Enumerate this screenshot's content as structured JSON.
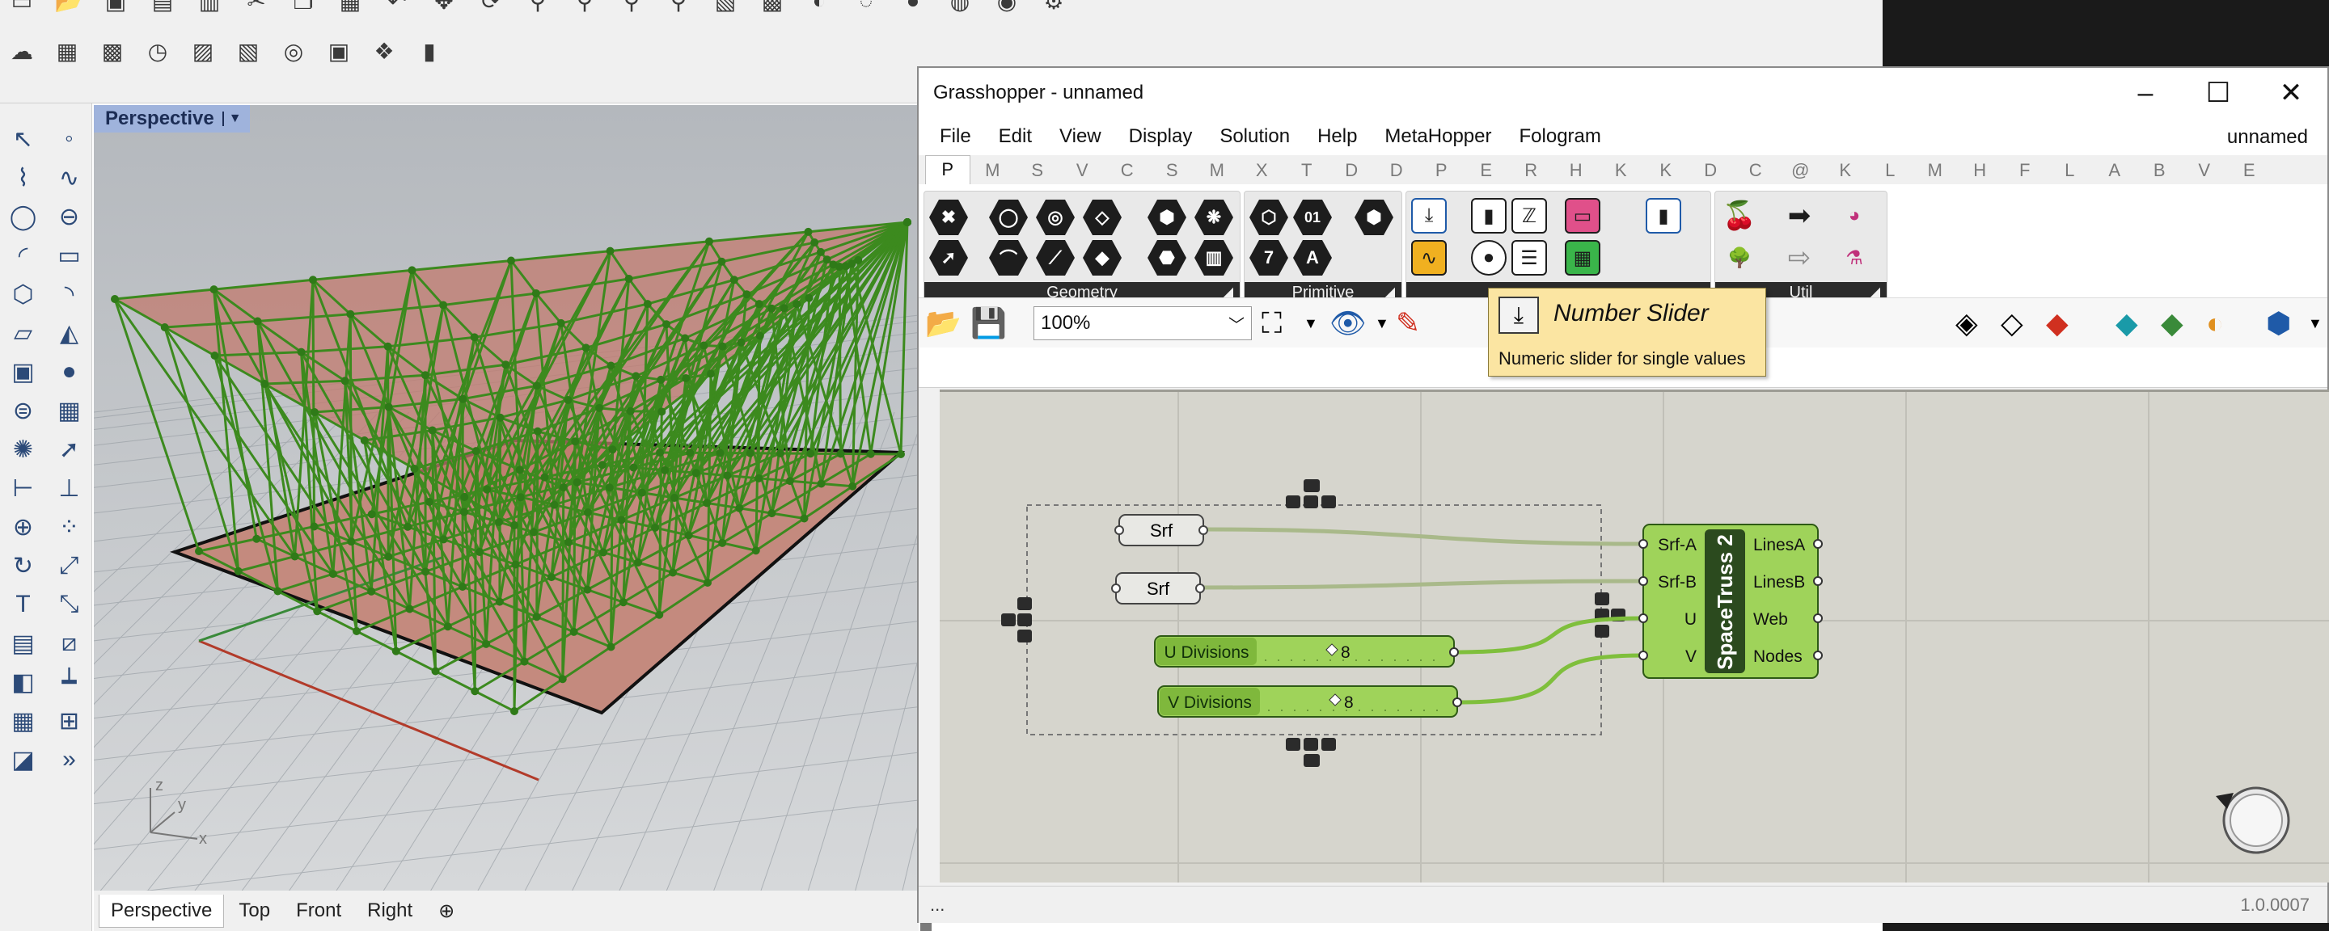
{
  "rhino": {
    "viewport_title": "Perspective",
    "viewport_tabs": [
      "Perspective",
      "Top",
      "Front",
      "Right"
    ],
    "add_tab_symbol": "⊕",
    "axis_labels": {
      "x": "x",
      "y": "y",
      "z": "z"
    }
  },
  "grasshopper": {
    "window_title": "Grasshopper - unnamed",
    "menu": [
      "File",
      "Edit",
      "View",
      "Display",
      "Solution",
      "Help",
      "MetaHopper",
      "Fologram"
    ],
    "document_name": "unnamed",
    "tabs": [
      "P",
      "M",
      "S",
      "V",
      "C",
      "S",
      "M",
      "X",
      "T",
      "D",
      "D",
      "P",
      "E",
      "R",
      "H",
      "K",
      "K",
      "D",
      "C",
      "@",
      "K",
      "L",
      "M",
      "H",
      "F",
      "L",
      "A",
      "B",
      "V",
      "E"
    ],
    "active_tab_index": 0,
    "panels": [
      {
        "label": "Geometry"
      },
      {
        "label": "Primitive"
      },
      {
        "label": ""
      },
      {
        "label": "Util"
      }
    ],
    "primitive_glyphs": [
      "01",
      "7",
      "A"
    ],
    "zoom": "100%",
    "tooltip": {
      "title": "Number Slider",
      "description": "Numeric slider for single values"
    },
    "canvas": {
      "srf_params": [
        "Srf",
        "Srf"
      ],
      "sliders": [
        {
          "label": "U Divisions",
          "value": "8"
        },
        {
          "label": "V Divisions",
          "value": "8"
        }
      ],
      "component": {
        "name": "SpaceTruss 2",
        "inputs": [
          "Srf-A",
          "Srf-B",
          "U",
          "V"
        ],
        "outputs": [
          "LinesA",
          "LinesB",
          "Web",
          "Nodes"
        ]
      }
    },
    "status_left": "...",
    "version": "1.0.0007"
  },
  "colors": {
    "truss": "#3c8a1e",
    "surface": "#c27a6d",
    "component": "#8bc34a",
    "tooltip": "#fbe5a2",
    "canvas": "#d6d5cd"
  }
}
